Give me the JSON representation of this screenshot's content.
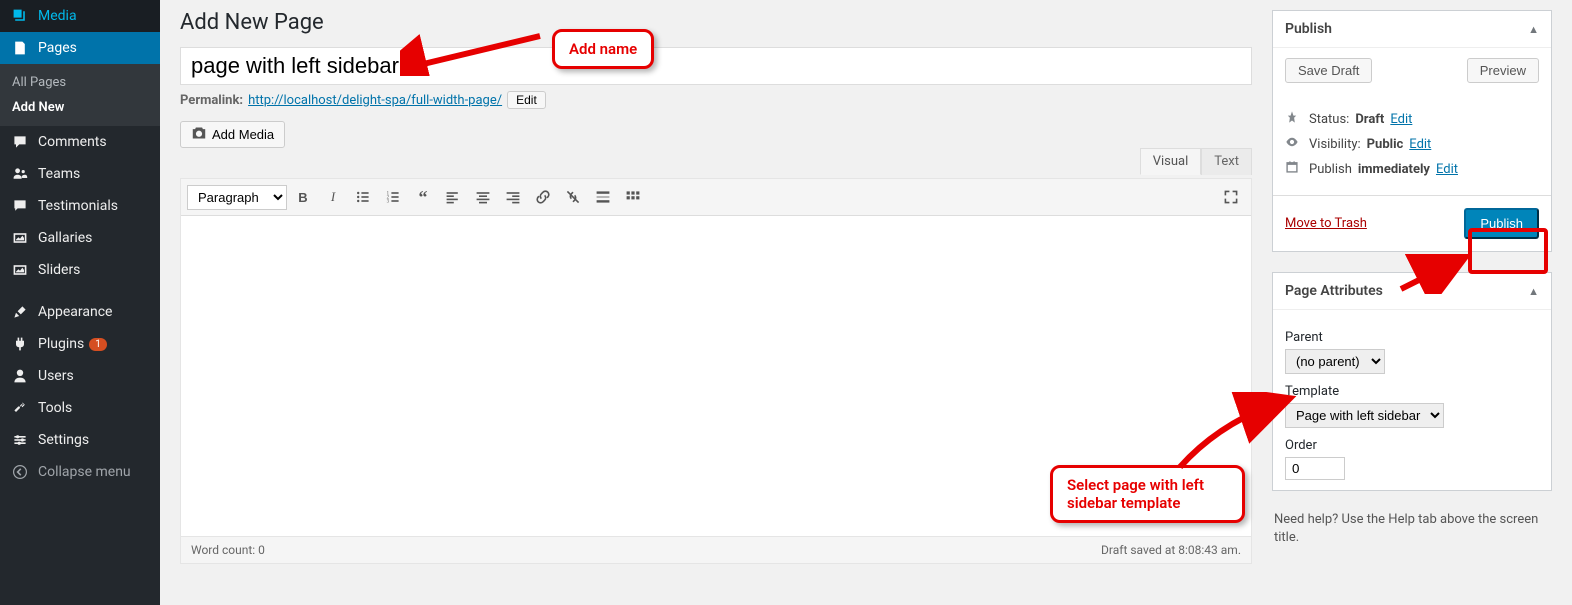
{
  "sidebar": {
    "items": [
      {
        "label": "Media",
        "icon": "media"
      },
      {
        "label": "Pages",
        "icon": "page",
        "active": true
      },
      {
        "label": "Comments",
        "icon": "comment"
      },
      {
        "label": "Teams",
        "icon": "teams"
      },
      {
        "label": "Testimonials",
        "icon": "testimonial"
      },
      {
        "label": "Gallaries",
        "icon": "gallery"
      },
      {
        "label": "Sliders",
        "icon": "slider"
      },
      {
        "label": "Appearance",
        "icon": "appearance"
      },
      {
        "label": "Plugins",
        "icon": "plugin",
        "badge": "1"
      },
      {
        "label": "Users",
        "icon": "user"
      },
      {
        "label": "Tools",
        "icon": "tool"
      },
      {
        "label": "Settings",
        "icon": "settings"
      },
      {
        "label": "Collapse menu",
        "icon": "collapse"
      }
    ],
    "submenu": [
      {
        "label": "All Pages"
      },
      {
        "label": "Add New",
        "current": true
      }
    ]
  },
  "page": {
    "heading": "Add New Page",
    "title_value": "page with left sidebar",
    "permalink_label": "Permalink:",
    "permalink_url": "http://localhost/delight-spa/full-width-page/",
    "edit_btn": "Edit",
    "add_media_btn": "Add Media"
  },
  "editor": {
    "tabs": {
      "visual": "Visual",
      "text": "Text"
    },
    "paragraph": "Paragraph",
    "word_count_label": "Word count: 0",
    "draft_saved": "Draft saved at 8:08:43 am."
  },
  "publish": {
    "title": "Publish",
    "save_draft": "Save Draft",
    "preview": "Preview",
    "status_label": "Status:",
    "status_value": "Draft",
    "visibility_label": "Visibility:",
    "visibility_value": "Public",
    "schedule_label": "Publish",
    "schedule_value": "immediately",
    "edit_link": "Edit",
    "trash": "Move to Trash",
    "publish_btn": "Publish"
  },
  "attributes": {
    "title": "Page Attributes",
    "parent_label": "Parent",
    "parent_value": "(no parent)",
    "template_label": "Template",
    "template_value": "Page with left sidebar",
    "order_label": "Order",
    "order_value": "0"
  },
  "help_text": "Need help? Use the Help tab above the screen title.",
  "annotations": {
    "add_name": "Add name",
    "select_template": "Select page with left sidebar template"
  }
}
